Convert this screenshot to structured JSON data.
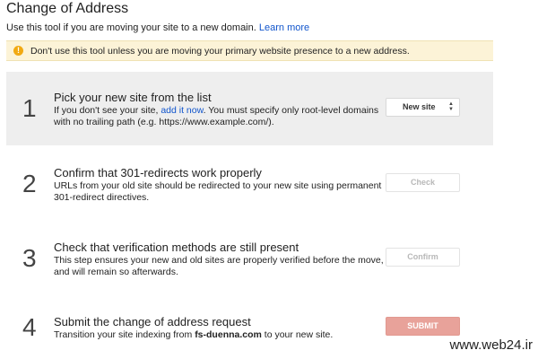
{
  "page": {
    "title": "Change of Address",
    "intro_text": "Use this tool if you are moving your site to a new domain.",
    "learn_more": "Learn more"
  },
  "warning": {
    "icon": "exclamation",
    "text": "Don't use this tool unless you are moving your primary website presence to a new address."
  },
  "steps": [
    {
      "number": "1",
      "title": "Pick your new site from the list",
      "desc_before": "If you don't see your site,",
      "desc_link": "add it now",
      "desc_after": ". You must specify only root-level domains with no trailing path (e.g. https://www.example.com/).",
      "button": "New site"
    },
    {
      "number": "2",
      "title": "Confirm that 301-redirects work properly",
      "desc": "URLs from your old site should be redirected to your new site using permanent 301-redirect directives.",
      "button": "Check"
    },
    {
      "number": "3",
      "title": "Check that verification methods are still present",
      "desc": "This step ensures your new and old sites are properly verified before the move, and will remain so afterwards.",
      "button": "Confirm"
    },
    {
      "number": "4",
      "title": "Submit the change of address request",
      "desc_before": "Transition your site indexing from",
      "desc_domain": "fs-duenna.com",
      "desc_after": "to your new site.",
      "button": "SUBMIT"
    }
  ],
  "watermark": "www.web24.ir",
  "colors": {
    "link": "#1155cc",
    "warning_bg": "#fcf3d7",
    "warning_icon": "#f1a912",
    "active_step_bg": "#eeeeee",
    "submit_bg": "#e8a29a"
  }
}
